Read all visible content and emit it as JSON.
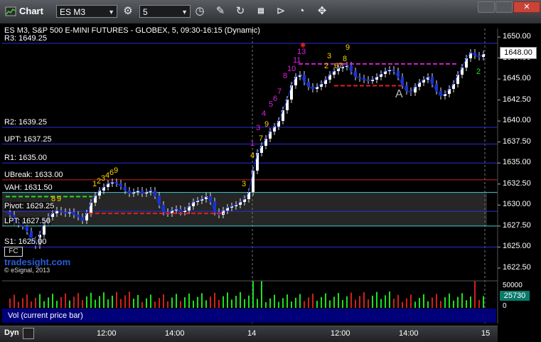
{
  "window": {
    "title": "Chart",
    "symbol": "ES M3",
    "interval": "5",
    "colors": {
      "frame": "#2e3034",
      "accent": "#1a9f4a"
    }
  },
  "toolbar": {
    "icons": [
      "gear-icon",
      "clock-icon",
      "pencil-icon",
      "refresh-icon",
      "study-icon",
      "play-icon",
      "move-icon"
    ]
  },
  "chart_data": {
    "type": "candlestick",
    "title": "ES M3, S&P 500 E-MINI FUTURES - GLOBEX, 5, 09:30-16:15 (Dynamic)",
    "y_ticks": [
      "1650.00",
      "1647.50",
      "1645.00",
      "1642.50",
      "1640.00",
      "1637.50",
      "1635.00",
      "1632.50",
      "1630.00",
      "1627.50",
      "1625.00",
      "1622.50"
    ],
    "ylim": [
      1621.5,
      1651.5
    ],
    "x_ticks": [
      "12:00",
      "14:00",
      "14",
      "12:00",
      "14:00",
      "15"
    ],
    "last_price": "1648.00",
    "levels": [
      {
        "label": "R3: 1649.25",
        "value": 1649.25,
        "color": "#2b2bd8"
      },
      {
        "label": "R2: 1639.25",
        "value": 1639.25,
        "color": "#2b2bd8"
      },
      {
        "label": "UPT: 1637.25",
        "value": 1637.25,
        "color": "#2b2bd8"
      },
      {
        "label": "R1: 1635.00",
        "value": 1635.0,
        "color": "#2b2bd8"
      },
      {
        "label": "UBreak: 1633.00",
        "value": 1633.0,
        "color": "#d02020"
      },
      {
        "label": "VAH: 1631.50",
        "value": 1631.5,
        "color": "#40d0d0"
      },
      {
        "label": "Pivot: 1629.25",
        "value": 1629.25,
        "color": "#2b2bd8"
      },
      {
        "label": "LPT: 1627.50",
        "value": 1627.5,
        "color": "#40d0d0"
      },
      {
        "label": "S1: 1625.00",
        "value": 1625.0,
        "color": "#2b2bd8"
      }
    ],
    "annotation": "A",
    "volume": {
      "label": "Vol (current price bar)",
      "last": "25730",
      "ticks": [
        "50000",
        "25000",
        "0"
      ],
      "ylim": [
        0,
        60000
      ]
    }
  },
  "overlay": {
    "watermark": "tradesight.com",
    "copyright": "© eSignal, 2013",
    "fc_badge": "FC",
    "dyn_label": "Dyn"
  }
}
